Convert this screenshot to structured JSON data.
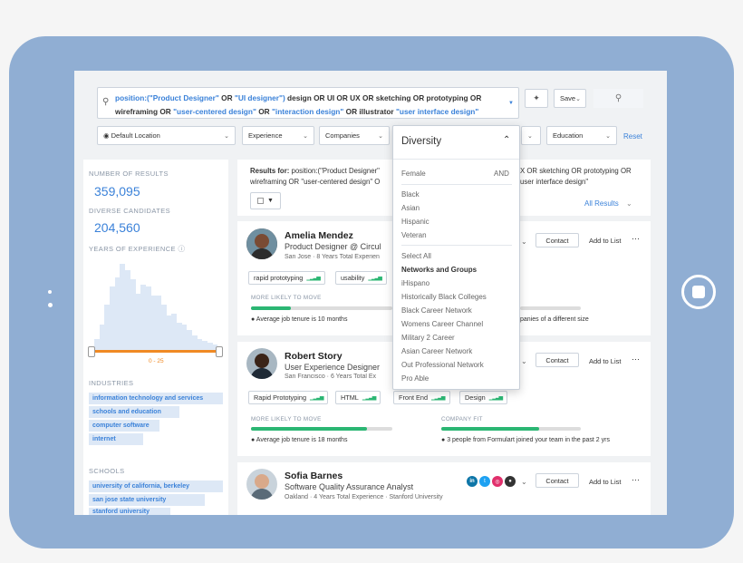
{
  "search": {
    "q1": "position:(\"Product Designer\"",
    "q2": "OR",
    "q3": "\"UI designer\")",
    "q4": "design OR UI OR UX OR sketching OR prototyping OR",
    "q5": "wireframing OR",
    "q6": "\"user-centered design\"",
    "q7": "OR",
    "q8": "\"interaction design\"",
    "q9": "OR illustrator",
    "q10": "\"user interface design\"",
    "save_label": "Save"
  },
  "filters": {
    "location": "Default Location",
    "experience": "Experience",
    "companies": "Companies",
    "education": "Education",
    "reset": "Reset"
  },
  "sidebar": {
    "results_label": "NUMBER OF RESULTS",
    "results_value": "359,095",
    "diverse_label": "DIVERSE CANDIDATES",
    "diverse_value": "204,560",
    "years_label": "YEARS OF EXPERIENCE",
    "range_label": "0 - 25",
    "industries_label": "INDUSTRIES",
    "industries": [
      "information technology and services",
      "schools and education",
      "computer software",
      "internet"
    ],
    "schools_label": "SCHOOLS",
    "schools": [
      "university of california, berkeley",
      "san jose state university",
      "stanford university"
    ]
  },
  "histogram": [
    0.12,
    0.28,
    0.5,
    0.7,
    0.8,
    0.95,
    0.88,
    0.78,
    0.62,
    0.72,
    0.7,
    0.6,
    0.6,
    0.5,
    0.38,
    0.4,
    0.3,
    0.28,
    0.22,
    0.16,
    0.12,
    0.1,
    0.08,
    0.06
  ],
  "results_header": {
    "prefix": "Results for:",
    "line1": "position:(\"Product Designer\"",
    "line1_tail": "X OR sketching OR prototyping OR",
    "line2": "wireframing OR \"user-centered design\" O",
    "line2_tail": "user interface design\"",
    "all_results": "All Results"
  },
  "candidates": [
    {
      "name": "Amelia Mendez",
      "title": "Product Designer @ Circul",
      "meta": "San Jose · 8 Years Total Experien",
      "tags": [
        "rapid prototyping",
        "usability"
      ],
      "move_label": "MORE LIKELY TO MOVE",
      "move": 0.28,
      "tenure": "Average job tenure is 10 months",
      "fit_tail": "panies of a different size",
      "contact": "Contact",
      "add": "Add to List"
    },
    {
      "name": "Robert Story",
      "title": "User Experience Designer",
      "meta": "San Francisco · 6 Years Total Ex",
      "tags": [
        "Rapid Prototyping",
        "HTML",
        "Front End",
        "Design"
      ],
      "move_label": "MORE LIKELY TO MOVE",
      "move": 0.82,
      "fit_label": "COMPANY FIT",
      "fit": 0.7,
      "tenure": "Average job tenure is 18 months",
      "fit_text": "3 people from Formulart joined your team in the past 2 yrs",
      "contact": "Contact",
      "add": "Add to List"
    },
    {
      "name": "Sofia Barnes",
      "title": "Software Quality Assurance Analyst",
      "meta": "Oakland · 4 Years Total Experience · Stanford University",
      "contact": "Contact",
      "add": "Add to List"
    }
  ],
  "diversity": {
    "title": "Diversity",
    "female": "Female",
    "and": "AND",
    "items": [
      "Black",
      "Asian",
      "Hispanic",
      "Veteran"
    ],
    "select_all": "Select All",
    "group_header": "Networks and Groups",
    "groups": [
      "iHispano",
      "Historically Black Colleges",
      "Black Career Network",
      "Womens Career Channel",
      "Military 2 Career",
      "Asian Career Network",
      "Out Professional Network",
      "Pro Able"
    ]
  },
  "social": {
    "in": "in",
    "tw": "t",
    "ig": "◎",
    "gh": "●"
  },
  "colors": {
    "accent": "#3b82d9",
    "green": "#2bb673",
    "orange": "#f08a24",
    "frame": "#90aed3"
  }
}
